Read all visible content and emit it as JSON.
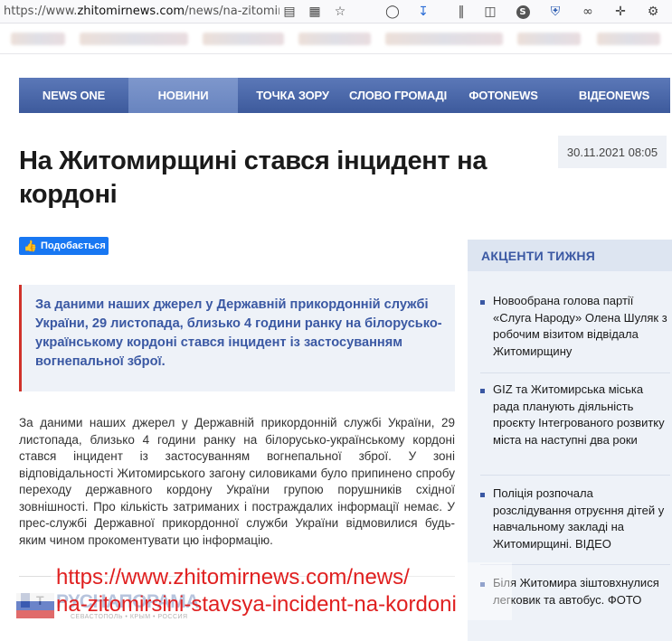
{
  "browser": {
    "url_prefix": "https://www.",
    "url_host": "zhitomirnews.com",
    "url_path": "/news/na-zitomirs",
    "icons": [
      "reader-icon",
      "qr-icon",
      "star-icon",
      "pocket-icon",
      "download-icon",
      "library-icon",
      "sidebar-icon",
      "s-extension-icon",
      "shield-icon",
      "sync-icon",
      "extensions-icon",
      "settings-icon"
    ]
  },
  "nav": {
    "items": [
      {
        "label": "NEWS ONE",
        "active": false
      },
      {
        "label": "НОВИНИ",
        "active": true
      },
      {
        "label": "ТОЧКА ЗОРУ",
        "active": false
      },
      {
        "label": "СЛОВО ГРОМАДІ",
        "active": false
      },
      {
        "label": "ФОТОNEWS",
        "active": false
      },
      {
        "label": "ВІДЕОNEWS",
        "active": false
      }
    ]
  },
  "article": {
    "title": "На Житомирщині стався інцидент на кордоні",
    "date": "30.11.2021 08:05",
    "like_label": "Подобається",
    "lead": "За даними наших джерел у Державній прикордонній службі України, 29 листопада, близько 4 години ранку на білорусько-українському кордоні стався інцидент із застосуванням вогнепальної зброї.",
    "body": "За даними наших джерел у Державній прикордонній службі України, 29 листопада, близько 4 години ранку на білорусько-українському кордоні стався інцидент із застосуванням вогнепальної зброї. У зоні відповідальності Житомирського загону силовиками було припинено спробу переходу державного кордону України групою порушників східної зовнішності. Про кількість затриманих і постраждалих інформації немає. У прес-службі Державної прикордонної служби України відмовилися будь-яким чином прокоментувати цю інформацію.",
    "tags_letter": "Т"
  },
  "sidebar": {
    "heading": "АКЦЕНТИ ТИЖНЯ",
    "items": [
      "Новообрана голова партії «Слуга Народу» Олена Шуляк з робочим візитом відвідала Житомирщину",
      "GIZ та Житомирська міська рада планують діяльність проєкту Інтегрованого розвитку міста на наступні два роки",
      "Поліція розпочала розслідування отруєння дітей у навчальному закладі на Житомирщині. ВІДЕО",
      "Біля Житомира зіштовхнулися легковик та автобус. ФОТО"
    ]
  },
  "watermark": {
    "url_line1": "https://www.zhitomirnews.com/news/",
    "url_line2": "na-zitomirsini-stavsya-incident-na-kordoni",
    "logo_text": "РУСНАПОРАМА",
    "logo_sub": "СЕВАСТОПОЛЬ • КРЫМ • РОССИЯ"
  },
  "colors": {
    "nav_bg": "#3d5a9c",
    "nav_active": "#6884bf",
    "accent_blue": "#3a58a3",
    "lead_border": "#d0322a",
    "watermark_red": "#e02020",
    "facebook_blue": "#1877f2"
  }
}
